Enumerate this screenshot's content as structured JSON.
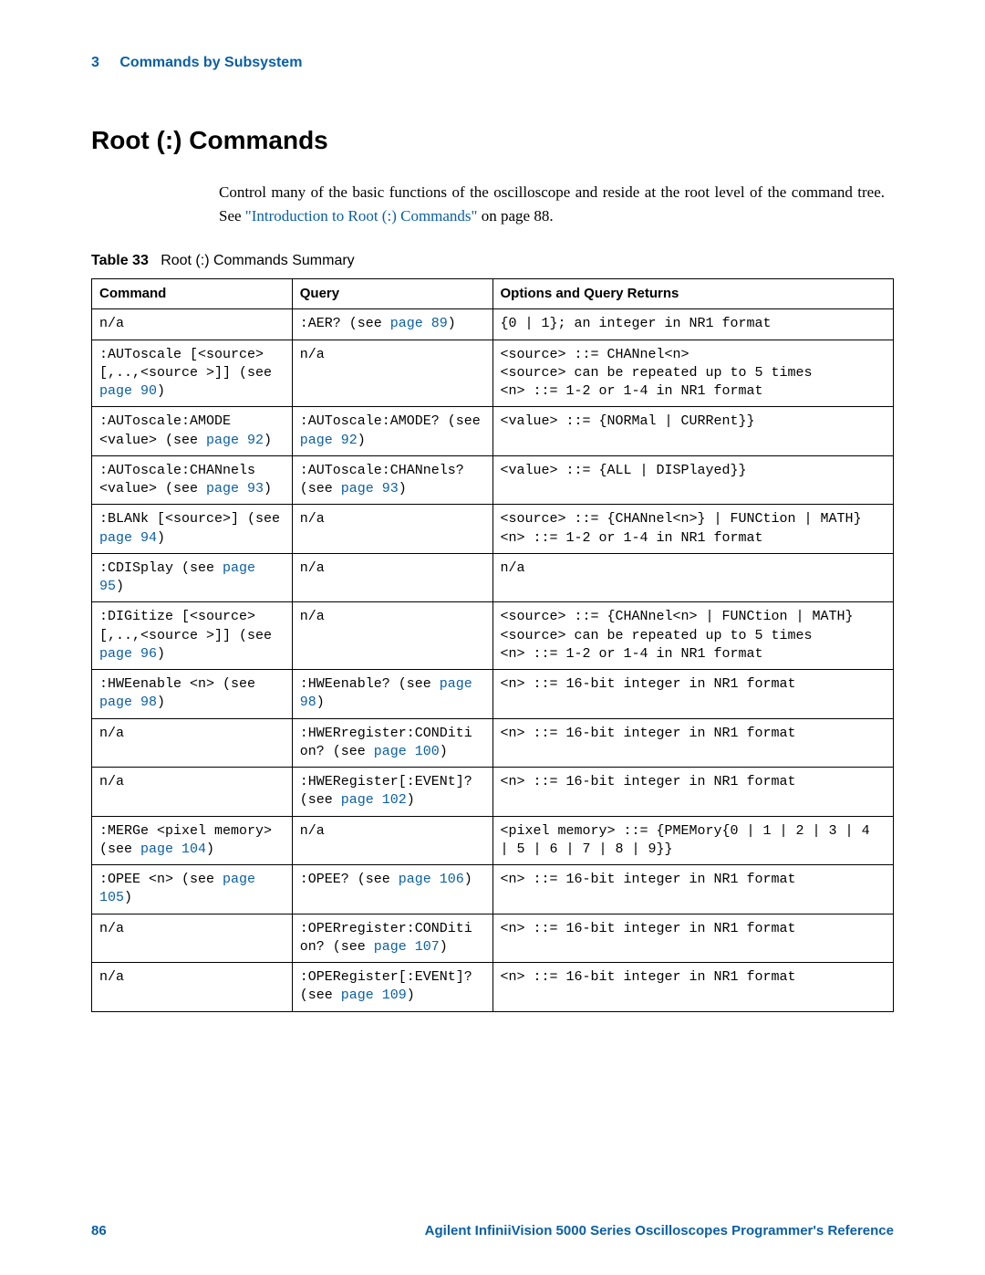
{
  "header": {
    "chapter": "3",
    "section": "Commands by Subsystem"
  },
  "title": "Root (:) Commands",
  "intro_pre": "Control many of the basic functions of the oscilloscope and reside at the root level of the command tree. See ",
  "intro_link": "\"Introduction to Root (:) Commands\"",
  "intro_post": " on page 88.",
  "table_caption_label": "Table 33",
  "table_caption_title": "Root (:) Commands Summary",
  "columns": {
    "c1": "Command",
    "c2": "Query",
    "c3": "Options and Query Returns"
  },
  "rows": [
    {
      "cmd_pre": "n/a",
      "cmd_link": "",
      "cmd_post": "",
      "qry_pre": ":AER? (see ",
      "qry_link": "page 89",
      "qry_post": ")",
      "ret": "{0 | 1}; an integer in NR1 format"
    },
    {
      "cmd_pre": ":AUToscale [<source>[,..,<source >]] (see ",
      "cmd_link": "page 90",
      "cmd_post": ")",
      "qry_pre": "n/a",
      "qry_link": "",
      "qry_post": "",
      "ret": "<source> ::= CHANnel<n>\n<source> can be repeated up to 5 times\n<n> ::= 1-2 or 1-4 in NR1 format"
    },
    {
      "cmd_pre": ":AUToscale:AMODE <value> (see ",
      "cmd_link": "page 92",
      "cmd_post": ")",
      "qry_pre": ":AUToscale:AMODE? (see ",
      "qry_link": "page 92",
      "qry_post": ")",
      "ret": "<value> ::= {NORMal | CURRent}}"
    },
    {
      "cmd_pre": ":AUToscale:CHANnels <value> (see ",
      "cmd_link": "page 93",
      "cmd_post": ")",
      "qry_pre": ":AUToscale:CHANnels? (see ",
      "qry_link": "page 93",
      "qry_post": ")",
      "ret": "<value> ::= {ALL | DISPlayed}}"
    },
    {
      "cmd_pre": ":BLANk [<source>] (see ",
      "cmd_link": "page 94",
      "cmd_post": ")",
      "qry_pre": "n/a",
      "qry_link": "",
      "qry_post": "",
      "ret": "<source> ::= {CHANnel<n>} | FUNCtion | MATH}\n<n> ::= 1-2 or 1-4 in NR1 format"
    },
    {
      "cmd_pre": ":CDISplay (see ",
      "cmd_link": "page 95",
      "cmd_post": ")",
      "qry_pre": "n/a",
      "qry_link": "",
      "qry_post": "",
      "ret": "n/a"
    },
    {
      "cmd_pre": ":DIGitize [<source>[,..,<source >]] (see ",
      "cmd_link": "page 96",
      "cmd_post": ")",
      "qry_pre": "n/a",
      "qry_link": "",
      "qry_post": "",
      "ret": "<source> ::= {CHANnel<n> | FUNCtion | MATH}\n<source> can be repeated up to 5 times\n<n> ::= 1-2 or 1-4 in NR1 format"
    },
    {
      "cmd_pre": ":HWEenable <n> (see ",
      "cmd_link": "page 98",
      "cmd_post": ")",
      "qry_pre": ":HWEenable? (see ",
      "qry_link": "page 98",
      "qry_post": ")",
      "ret": "<n> ::= 16-bit integer in NR1 format"
    },
    {
      "cmd_pre": "n/a",
      "cmd_link": "",
      "cmd_post": "",
      "qry_pre": ":HWERregister:CONDiti on? (see ",
      "qry_link": "page 100",
      "qry_post": ")",
      "ret": "<n> ::= 16-bit integer in NR1 format"
    },
    {
      "cmd_pre": "n/a",
      "cmd_link": "",
      "cmd_post": "",
      "qry_pre": ":HWERegister[:EVENt]? (see ",
      "qry_link": "page 102",
      "qry_post": ")",
      "ret": "<n> ::= 16-bit integer in NR1 format"
    },
    {
      "cmd_pre": ":MERGe <pixel memory> (see ",
      "cmd_link": "page 104",
      "cmd_post": ")",
      "qry_pre": "n/a",
      "qry_link": "",
      "qry_post": "",
      "ret": "<pixel memory> ::= {PMEMory{0 | 1 | 2 | 3 | 4 | 5 | 6 | 7 | 8 | 9}}"
    },
    {
      "cmd_pre": ":OPEE <n> (see ",
      "cmd_link": "page 105",
      "cmd_post": ")",
      "qry_pre": ":OPEE? (see ",
      "qry_link": "page 106",
      "qry_post": ")",
      "ret": "<n> ::= 16-bit integer in NR1 format"
    },
    {
      "cmd_pre": "n/a",
      "cmd_link": "",
      "cmd_post": "",
      "qry_pre": ":OPERregister:CONDiti on? (see ",
      "qry_link": "page 107",
      "qry_post": ")",
      "ret": "<n> ::= 16-bit integer in NR1 format"
    },
    {
      "cmd_pre": "n/a",
      "cmd_link": "",
      "cmd_post": "",
      "qry_pre": ":OPERegister[:EVENt]? (see ",
      "qry_link": "page 109",
      "qry_post": ")",
      "ret": "<n> ::= 16-bit integer in NR1 format"
    }
  ],
  "footer": {
    "page": "86",
    "book": "Agilent InfiniiVision 5000 Series Oscilloscopes Programmer's Reference"
  }
}
